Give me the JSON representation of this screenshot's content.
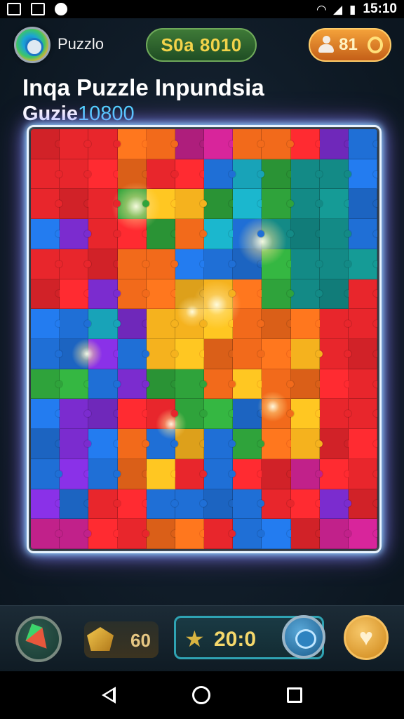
{
  "status_bar": {
    "time": "15:10",
    "left_icons": [
      "gallery-icon",
      "image-icon",
      "game-controller-icon"
    ],
    "right_icons": [
      "wifi-icon",
      "signal-icon",
      "battery-icon"
    ]
  },
  "header": {
    "app_name": "Puzzlo",
    "score": "S0a 8010",
    "coins": "81",
    "title_line1": "Inqa Puzzle Inpundsia",
    "title_line2_prefix": "Guzie",
    "title_line2_highlight": "10800"
  },
  "board": {
    "cols": 12,
    "rows": 14,
    "palette": {
      "R": "#e8262c",
      "O": "#f26a1b",
      "Y": "#f5b21e",
      "G": "#2fa33b",
      "B": "#1f6fd6",
      "C": "#18a3b8",
      "P": "#7b2ccf",
      "M": "#c1218a",
      "T": "#138a86"
    },
    "layout": [
      "RRROOMMOORPB",
      "RRRORRBCGTTB",
      "RRRGYYGCGTTB",
      "BPRRGOCBTTTB",
      "RRROOBBBGTTT",
      "RRPOOYYOGTTR",
      "BBCPYYYOOORR",
      "BBPBYYOOOYRR",
      "GGBPGGOYOORR",
      "BPPRRGGBOYRR",
      "BPBOBYBGOYRR",
      "BPBOYRBRRMRR",
      "PBRRBBBBRRPR",
      "MMRROORBBRMM"
    ]
  },
  "controls": {
    "pieces_value": "60",
    "stars_value": "20:0"
  },
  "nav": {
    "back": "back-icon",
    "home": "home-icon",
    "recents": "recents-icon"
  }
}
